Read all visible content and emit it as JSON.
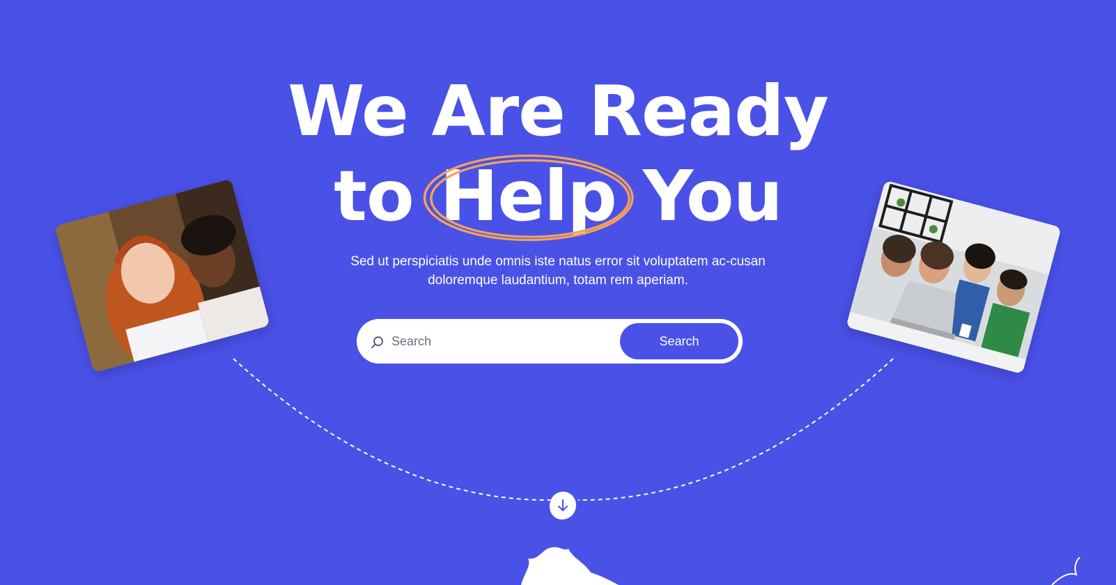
{
  "hero": {
    "headline_line1": "We Are Ready",
    "headline_line2_before": "to",
    "headline_line2_highlight": "Help",
    "headline_line2_after": "You",
    "subtitle": "Sed ut perspiciatis unde omnis iste natus error sit voluptatem ac-cusan doloremque laudantium, totam rem aperiam."
  },
  "search": {
    "placeholder": "Search",
    "button_label": "Search"
  },
  "colors": {
    "background": "#4a51e7",
    "highlight_ring": "#f2a25a",
    "button": "#4a51e7",
    "text": "#ffffff"
  },
  "icons": {
    "search": "magnifier-icon",
    "scroll": "arrow-down-icon"
  }
}
